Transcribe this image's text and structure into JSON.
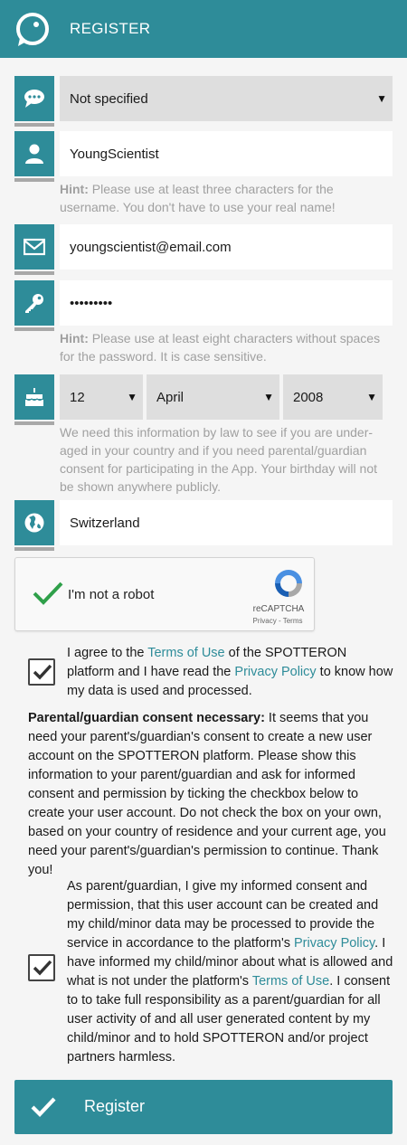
{
  "header": {
    "title": "REGISTER"
  },
  "gender": {
    "value": "Not specified"
  },
  "username": {
    "value": "YoungScientist",
    "hint_label": "Hint:",
    "hint_text": " Please use at least three characters for the username. You don't have to use your real name!"
  },
  "email": {
    "value": "youngscientist@email.com"
  },
  "password": {
    "value": "•••••••••",
    "hint_label": "Hint:",
    "hint_text": " Please use at least eight characters without spaces for the password. It is case sensitive."
  },
  "birthday": {
    "day": "12",
    "month": "April",
    "year": "2008",
    "hint_text": "We need this information by law to see if you are under-aged in your country and if you need parental/guardian consent for participating in the App. Your birthday will not be shown anywhere publicly."
  },
  "country": {
    "value": "Switzerland"
  },
  "recaptcha": {
    "label": "I'm not a robot",
    "brand": "reCAPTCHA",
    "links": "Privacy - Terms"
  },
  "terms": {
    "t1": "I agree to the ",
    "link1": "Terms of Use",
    "t2": " of the SPOTTERON platform and I have read the ",
    "link2": "Privacy Policy",
    "t3": " to know how my data is used and processed."
  },
  "notice": {
    "title": "Parental/guardian consent necessary:",
    "text": " It seems that you need your parent's/guardian's consent to create a new user account on the SPOTTERON platform. Please show this information to your parent/guardian and ask for informed consent and permission by ticking the checkbox below to create your user account. Do not check the box on your own, based on your country of residence and your current age, you need your parent's/guardian's permission to continue. Thank you!"
  },
  "parental": {
    "t1": "As parent/guardian, I give my informed consent and permission, that this user account can be created and my child/minor data may be processed to provide the service in accordance to the platform's ",
    "link1": "Privacy Policy",
    "t2": ". I have informed my child/minor about what is allowed and what is not under the platform's ",
    "link2": "Terms of Use",
    "t3": ". I consent to to take full responsibility as a parent/guardian for all user activity of and all user generated content by my child/minor and to hold SPOTTERON and/or project partners harmless."
  },
  "register_button": {
    "label": "Register"
  },
  "colors": {
    "accent": "#2e8c99",
    "link": "#2e8c99"
  }
}
